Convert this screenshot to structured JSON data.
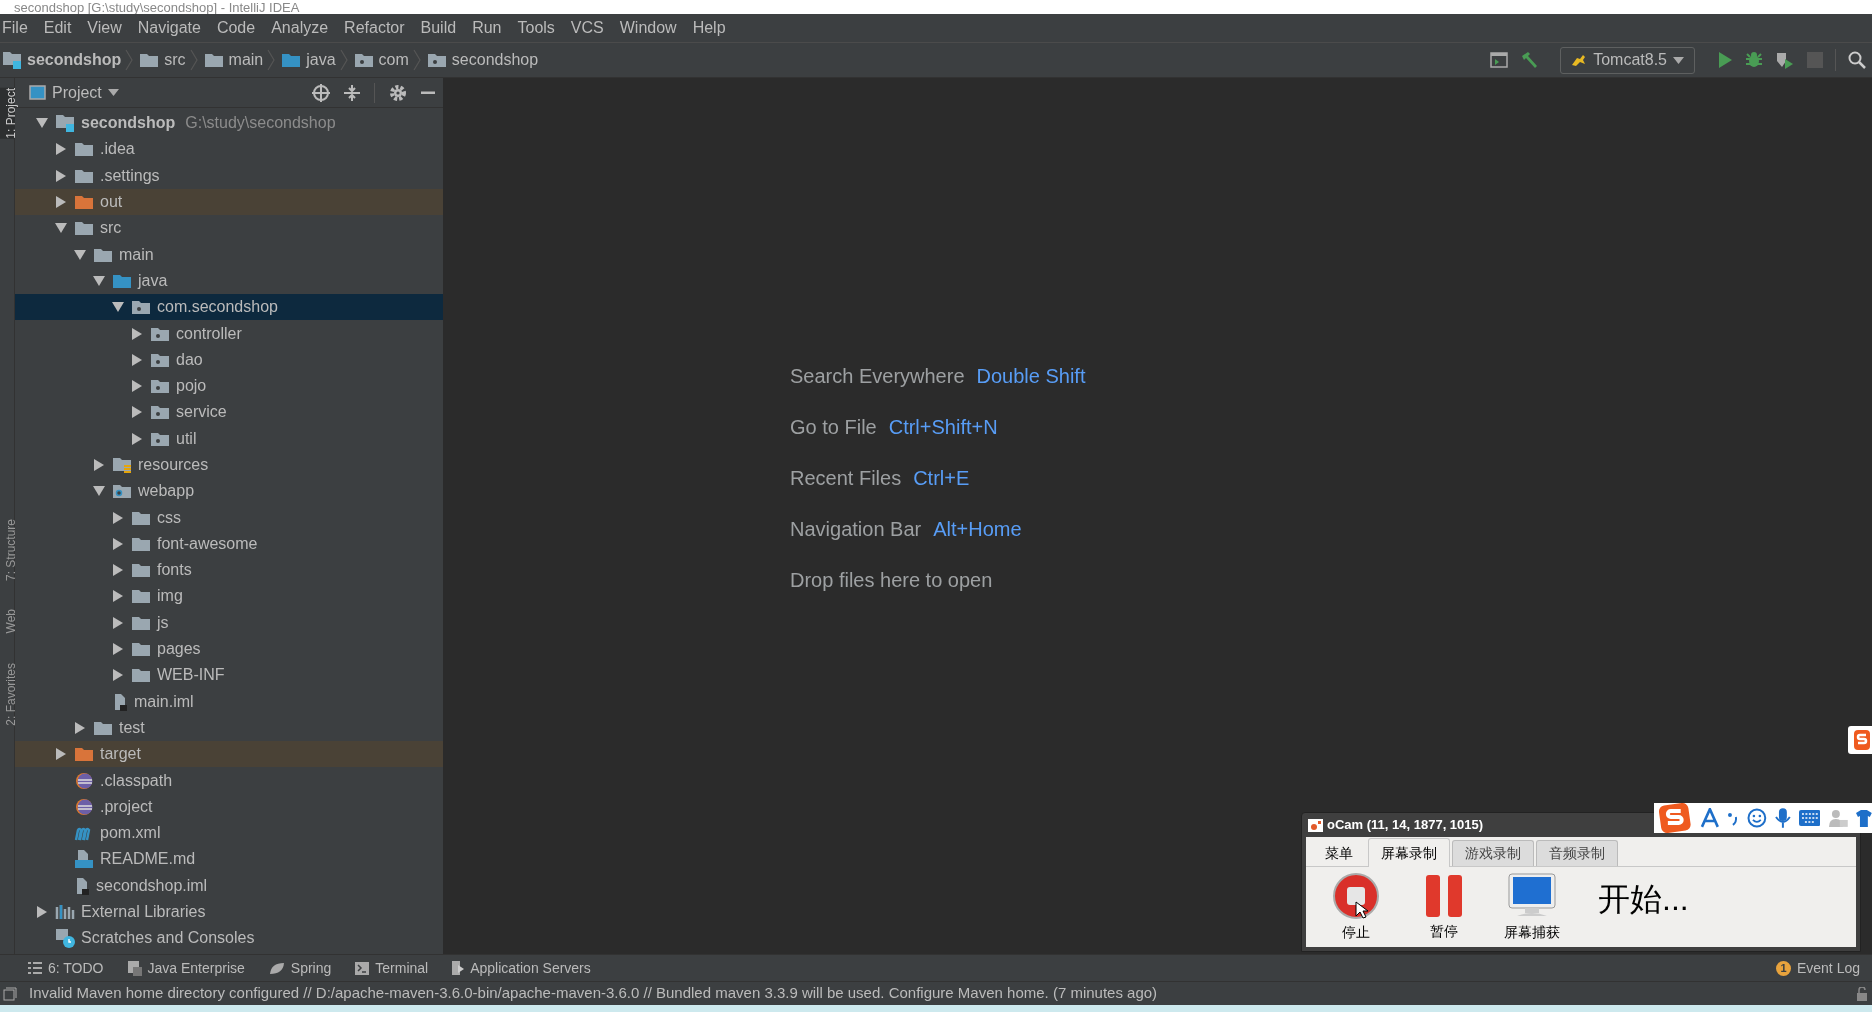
{
  "window": {
    "title": "secondshop [G:\\study\\secondshop] - IntelliJ IDEA"
  },
  "menu": [
    "File",
    "Edit",
    "View",
    "Navigate",
    "Code",
    "Analyze",
    "Refactor",
    "Build",
    "Run",
    "Tools",
    "VCS",
    "Window",
    "Help"
  ],
  "breadcrumbs": [
    {
      "label": "secondshop",
      "kind": "module"
    },
    {
      "label": "src",
      "kind": "folder"
    },
    {
      "label": "main",
      "kind": "folder"
    },
    {
      "label": "java",
      "kind": "source"
    },
    {
      "label": "com",
      "kind": "package"
    },
    {
      "label": "secondshop",
      "kind": "package"
    }
  ],
  "run_config": "Tomcat8.5",
  "side_tabs": [
    {
      "label": "1: Project",
      "selected": true
    },
    {
      "label": "7: Structure",
      "selected": false
    },
    {
      "label": "Web",
      "selected": false
    },
    {
      "label": "2: Favorites",
      "selected": false
    }
  ],
  "project_panel": {
    "title": "Project"
  },
  "tree": [
    {
      "label": "secondshop",
      "hint": "G:\\study\\secondshop",
      "kind": "module",
      "expanded": true,
      "selected": false,
      "excluded": false,
      "children": [
        {
          "label": ".idea",
          "kind": "folder",
          "expanded": false,
          "selected": false,
          "excluded": false
        },
        {
          "label": ".settings",
          "kind": "folder",
          "expanded": false,
          "selected": false,
          "excluded": false
        },
        {
          "label": "out",
          "kind": "folder",
          "expanded": false,
          "selected": false,
          "excluded": true
        },
        {
          "label": "src",
          "kind": "folder",
          "expanded": true,
          "selected": false,
          "excluded": false,
          "children": [
            {
              "label": "main",
              "kind": "folder",
              "expanded": true,
              "selected": false,
              "excluded": false,
              "children": [
                {
                  "label": "java",
                  "kind": "source",
                  "expanded": true,
                  "selected": false,
                  "excluded": false,
                  "children": [
                    {
                      "label": "com.secondshop",
                      "kind": "package",
                      "expanded": true,
                      "selected": true,
                      "excluded": false,
                      "children": [
                        {
                          "label": "controller",
                          "kind": "package",
                          "expanded": false,
                          "selected": false,
                          "excluded": false
                        },
                        {
                          "label": "dao",
                          "kind": "package",
                          "expanded": false,
                          "selected": false,
                          "excluded": false
                        },
                        {
                          "label": "pojo",
                          "kind": "package",
                          "expanded": false,
                          "selected": false,
                          "excluded": false
                        },
                        {
                          "label": "service",
                          "kind": "package",
                          "expanded": false,
                          "selected": false,
                          "excluded": false
                        },
                        {
                          "label": "util",
                          "kind": "package",
                          "expanded": false,
                          "selected": false,
                          "excluded": false
                        }
                      ]
                    }
                  ]
                },
                {
                  "label": "resources",
                  "kind": "resources",
                  "expanded": false,
                  "selected": false,
                  "excluded": false
                },
                {
                  "label": "webapp",
                  "kind": "web",
                  "expanded": true,
                  "selected": false,
                  "excluded": false,
                  "children": [
                    {
                      "label": "css",
                      "kind": "folder",
                      "expanded": false,
                      "selected": false,
                      "excluded": false
                    },
                    {
                      "label": "font-awesome",
                      "kind": "folder",
                      "expanded": false,
                      "selected": false,
                      "excluded": false
                    },
                    {
                      "label": "fonts",
                      "kind": "folder",
                      "expanded": false,
                      "selected": false,
                      "excluded": false
                    },
                    {
                      "label": "img",
                      "kind": "folder",
                      "expanded": false,
                      "selected": false,
                      "excluded": false
                    },
                    {
                      "label": "js",
                      "kind": "folder",
                      "expanded": false,
                      "selected": false,
                      "excluded": false
                    },
                    {
                      "label": "pages",
                      "kind": "folder",
                      "expanded": false,
                      "selected": false,
                      "excluded": false
                    },
                    {
                      "label": "WEB-INF",
                      "kind": "folder",
                      "expanded": false,
                      "selected": false,
                      "excluded": false
                    }
                  ]
                },
                {
                  "label": "main.iml",
                  "kind": "iml",
                  "selected": false,
                  "excluded": false
                }
              ]
            },
            {
              "label": "test",
              "kind": "folder",
              "expanded": false,
              "selected": false,
              "excluded": false
            }
          ]
        },
        {
          "label": "target",
          "kind": "folder",
          "expanded": false,
          "selected": false,
          "excluded": true
        },
        {
          "label": ".classpath",
          "kind": "eclipse",
          "selected": false,
          "excluded": false
        },
        {
          "label": ".project",
          "kind": "eclipse",
          "selected": false,
          "excluded": false
        },
        {
          "label": "pom.xml",
          "kind": "maven",
          "selected": false,
          "excluded": false
        },
        {
          "label": "README.md",
          "kind": "markdown",
          "selected": false,
          "excluded": false
        },
        {
          "label": "secondshop.iml",
          "kind": "iml",
          "selected": false,
          "excluded": false
        }
      ]
    },
    {
      "label": "External Libraries",
      "kind": "libraries",
      "expanded": false,
      "selected": false,
      "excluded": false
    },
    {
      "label": "Scratches and Consoles",
      "kind": "scratches",
      "selected": false,
      "excluded": false
    }
  ],
  "hints": [
    {
      "label": "Search Everywhere",
      "shortcut": "Double Shift"
    },
    {
      "label": "Go to File",
      "shortcut": "Ctrl+Shift+N"
    },
    {
      "label": "Recent Files",
      "shortcut": "Ctrl+E"
    },
    {
      "label": "Navigation Bar",
      "shortcut": "Alt+Home"
    },
    {
      "label": "Drop files here to open"
    }
  ],
  "bottom_tabs": [
    {
      "label": "6: TODO",
      "kind": "todo"
    },
    {
      "label": "Java Enterprise",
      "kind": "enterprise"
    },
    {
      "label": "Spring",
      "kind": "spring"
    },
    {
      "label": "Terminal",
      "kind": "terminal"
    },
    {
      "label": "Application Servers",
      "kind": "servers"
    }
  ],
  "event_log": {
    "label": "Event Log",
    "count": "1"
  },
  "status_bar": "Invalid Maven home directory configured // D:/apache-maven-3.6.0-bin/apache-maven-3.6.0 // Bundled maven 3.3.9 will be used.  Configure Maven home. (7 minutes ago)",
  "ocam": {
    "title": "oCam (11, 14, 1877, 1015)",
    "tabs": [
      {
        "label": "菜单",
        "selected": false
      },
      {
        "label": "屏幕录制",
        "selected": true
      },
      {
        "label": "游戏录制",
        "selected": false
      },
      {
        "label": "音频录制",
        "selected": false
      }
    ],
    "buttons": [
      {
        "label": "停止",
        "kind": "stop"
      },
      {
        "label": "暂停",
        "kind": "pause"
      },
      {
        "label": "屏幕捕获",
        "kind": "capture"
      }
    ],
    "status": "开始..."
  }
}
